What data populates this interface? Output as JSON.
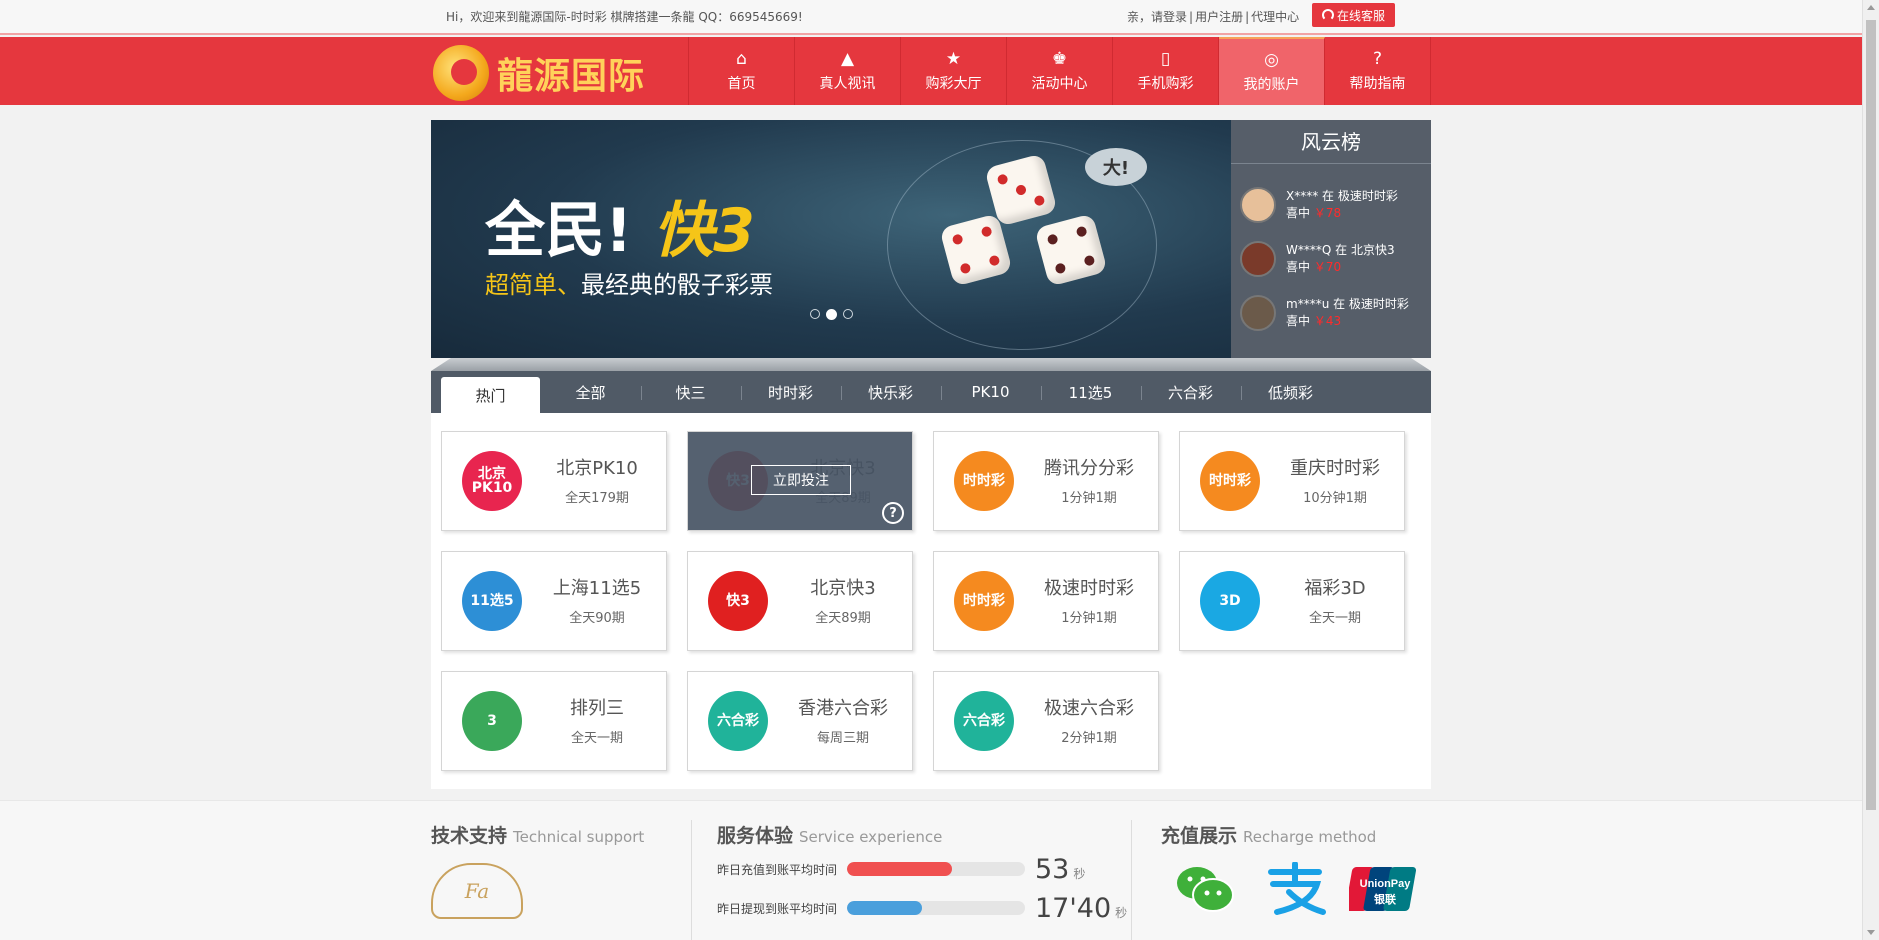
{
  "topbar": {
    "welcome": "Hi，欢迎来到龍源国际-时时彩 棋牌搭建一条龍 QQ：669545669!",
    "login": "亲，请登录",
    "register": "用户注册",
    "agent": "代理中心",
    "service": "在线客服"
  },
  "logo": {
    "text": "龍源国际"
  },
  "nav": [
    {
      "label": "首页",
      "icon": "home-icon"
    },
    {
      "label": "真人视讯",
      "icon": "live-icon"
    },
    {
      "label": "购彩大厅",
      "icon": "star-icon"
    },
    {
      "label": "活动中心",
      "icon": "gift-icon"
    },
    {
      "label": "手机购彩",
      "icon": "phone-icon"
    },
    {
      "label": "我的账户",
      "icon": "user-icon",
      "active": true
    },
    {
      "label": "帮助指南",
      "icon": "help-icon"
    }
  ],
  "banner": {
    "headline_a": "全民!",
    "headline_b": "快3",
    "sub_a": "超简单、",
    "sub_b": "最经典的骰子彩票",
    "bubble": "大!"
  },
  "ranking": {
    "title": "风云榜",
    "rows": [
      {
        "line1": "X**** 在 极速时时彩",
        "prefix": "喜中",
        "amount": "￥78"
      },
      {
        "line1": "W****Q 在 北京快3",
        "prefix": "喜中",
        "amount": "￥70"
      },
      {
        "line1": "m****u 在 极速时时彩",
        "prefix": "喜中",
        "amount": "￥43"
      }
    ]
  },
  "tabs": [
    "热门",
    "全部",
    "快三",
    "时时彩",
    "快乐彩",
    "PK10",
    "11选5",
    "六合彩",
    "低频彩"
  ],
  "games": [
    {
      "name": "北京PK10",
      "desc": "全天179期",
      "color": "#e8254f",
      "icon_text": "北京 PK10"
    },
    {
      "name": "北京快3",
      "desc": "全天89期",
      "color": "#e02020",
      "icon_text": "快3",
      "hover": true,
      "bet": "立即投注",
      "help": "?"
    },
    {
      "name": "腾讯分分彩",
      "desc": "1分钟1期",
      "color": "#f58a1f",
      "icon_text": "时时彩"
    },
    {
      "name": "重庆时时彩",
      "desc": "10分钟1期",
      "color": "#f58a1f",
      "icon_text": "时时彩"
    },
    {
      "name": "上海11选5",
      "desc": "全天90期",
      "color": "#2d8fd6",
      "icon_text": "11选5"
    },
    {
      "name": "北京快3",
      "desc": "全天89期",
      "color": "#e02020",
      "icon_text": "快3"
    },
    {
      "name": "极速时时彩",
      "desc": "1分钟1期",
      "color": "#f58a1f",
      "icon_text": "时时彩"
    },
    {
      "name": "福彩3D",
      "desc": "全天一期",
      "color": "#1aa8e3",
      "icon_text": "3D"
    },
    {
      "name": "排列三",
      "desc": "全天一期",
      "color": "#3aa85a",
      "icon_text": "3"
    },
    {
      "name": "香港六合彩",
      "desc": "每周三期",
      "color": "#20b39a",
      "icon_text": "六合彩"
    },
    {
      "name": "极速六合彩",
      "desc": "2分钟1期",
      "color": "#20b39a",
      "icon_text": "六合彩"
    }
  ],
  "footer": {
    "tech": {
      "title": "技术支持",
      "en": "Technical support",
      "logo": "Fa"
    },
    "service": {
      "title": "服务体验",
      "en": "Service experience",
      "stats": [
        {
          "label": "昨日充值到账平均时间",
          "value": "53",
          "unit": "秒",
          "fill": 0.59,
          "color": "#f05050"
        },
        {
          "label": "昨日提现到账平均时间",
          "value": "17'40",
          "unit": "秒",
          "fill": 0.42,
          "color": "#4a9fdc"
        }
      ]
    },
    "recharge": {
      "title": "充值展示",
      "en": "Recharge method",
      "methods": [
        "wechat-icon",
        "alipay-icon",
        "unionpay-icon"
      ],
      "unionpay_a": "UnionPay",
      "unionpay_b": "银联"
    }
  }
}
